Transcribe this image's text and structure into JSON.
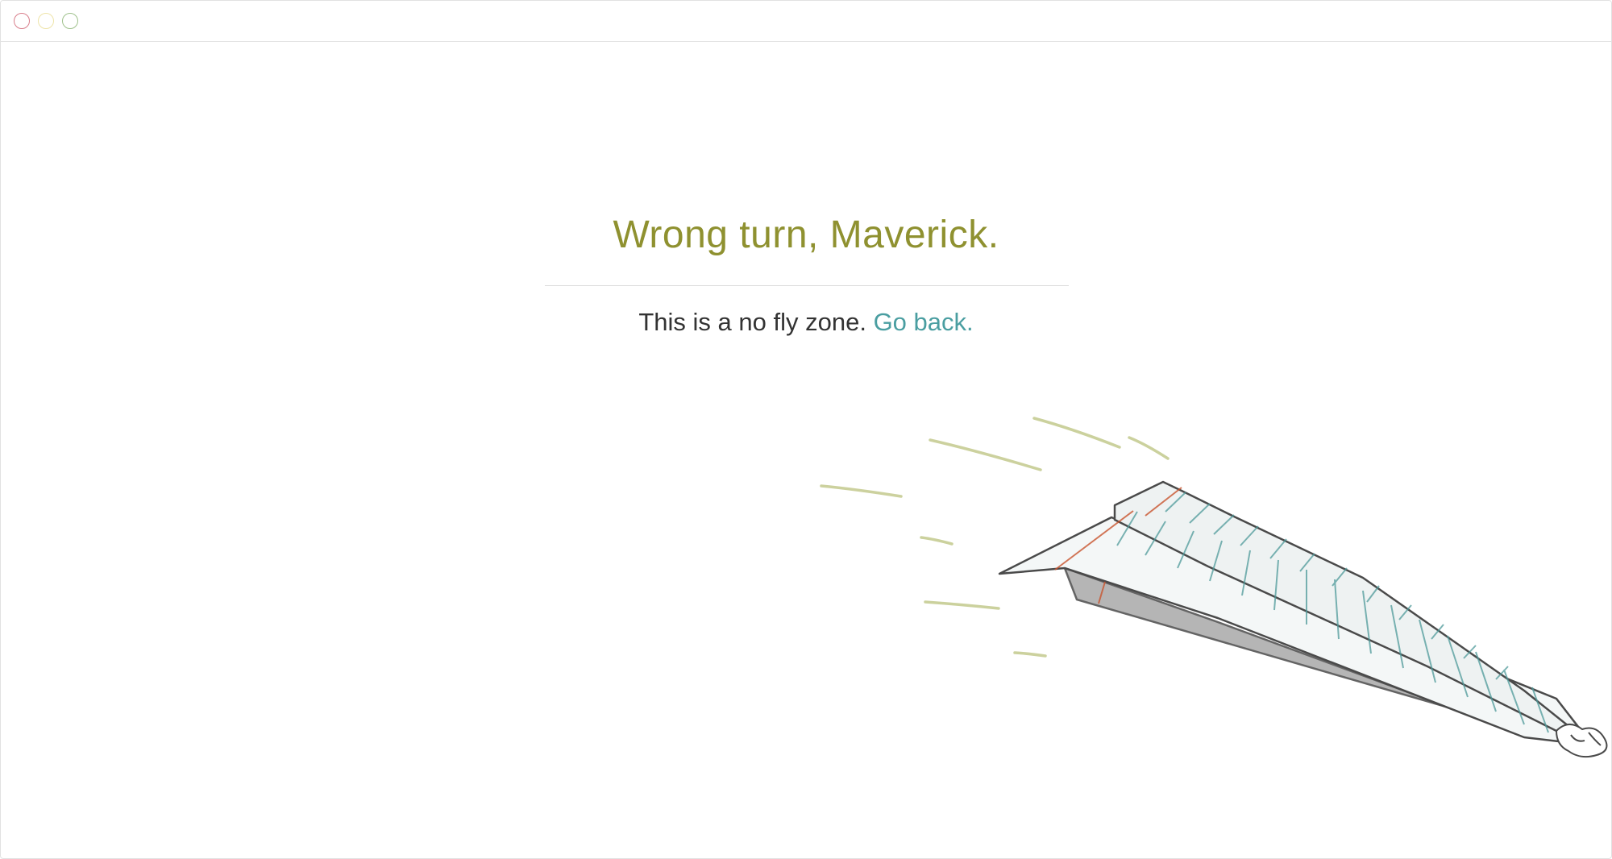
{
  "window": {
    "controls": [
      "close",
      "minimize",
      "maximize"
    ],
    "colors": {
      "close": "#d87f8c",
      "minimize": "#eee4a8",
      "maximize": "#9fc18c"
    }
  },
  "error_page": {
    "heading": "Wrong turn, Maverick.",
    "message": "This is a no fly zone.",
    "link_text": "Go back.",
    "colors": {
      "heading": "#8f9130",
      "message": "#333333",
      "link": "#4a9ea1"
    }
  },
  "illustration": {
    "icon": "paper-airplane-illustration"
  }
}
